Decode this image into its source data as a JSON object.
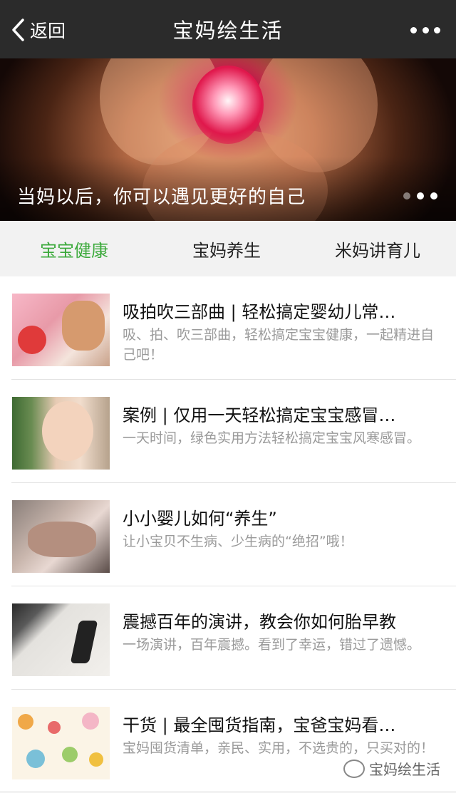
{
  "header": {
    "back_label": "返回",
    "title": "宝妈绘生活"
  },
  "banner": {
    "caption": "当妈以后，你可以遇见更好的自己",
    "slide_count": 3,
    "active_slide": 1
  },
  "tabs": [
    {
      "label": "宝宝健康",
      "active": true
    },
    {
      "label": "宝妈养生",
      "active": false
    },
    {
      "label": "米妈讲育儿",
      "active": false
    }
  ],
  "articles": [
    {
      "title": "吸拍吹三部曲 | 轻松搞定婴幼儿常…",
      "desc": "吸、拍、吹三部曲，轻松搞定宝宝健康，一起精进自己吧！"
    },
    {
      "title": "案例 | 仅用一天轻松搞定宝宝感冒…",
      "desc": "一天时间，绿色实用方法轻松搞定宝宝风寒感冒。"
    },
    {
      "title": "小小婴儿如何“养生”",
      "desc": "让小宝贝不生病、少生病的“绝招”哦！"
    },
    {
      "title": "震撼百年的演讲，教会你如何胎早教",
      "desc": "一场演讲，百年震撼。看到了幸运，错过了遗憾。"
    },
    {
      "title": "干货 | 最全囤货指南，宝爸宝妈看…",
      "desc": "宝妈囤货清单，亲民、实用，不选贵的，只买对的！"
    }
  ],
  "watermark": {
    "text": "宝妈绘生活"
  },
  "colors": {
    "topbar": "#2b2b2b",
    "active_tab": "#3caa3c",
    "desc_text": "#9a9a9a"
  }
}
